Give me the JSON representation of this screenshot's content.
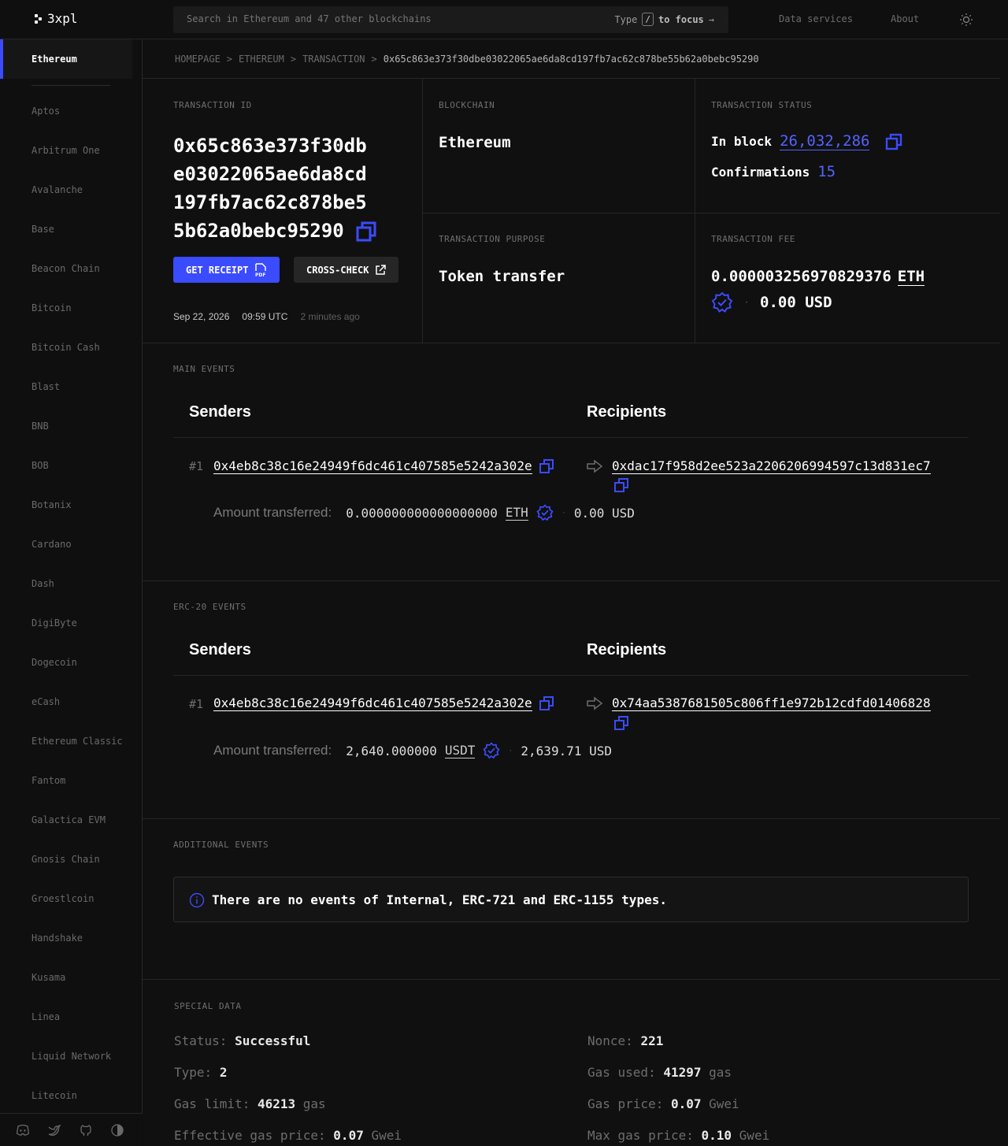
{
  "app": {
    "logo": "3xpl"
  },
  "topbar": {
    "search_placeholder": "Search in Ethereum and 47 other blockchains",
    "hint_type": "Type",
    "hint_key": "/",
    "hint_focus": "to focus",
    "nav": [
      "Data services",
      "About"
    ]
  },
  "sidebar": {
    "active": "Ethereum",
    "items": [
      "Aptos",
      "Arbitrum One",
      "Avalanche",
      "Base",
      "Beacon Chain",
      "Bitcoin",
      "Bitcoin Cash",
      "Blast",
      "BNB",
      "BOB",
      "Botanix",
      "Cardano",
      "Dash",
      "DigiByte",
      "Dogecoin",
      "eCash",
      "Ethereum Classic",
      "Fantom",
      "Galactica EVM",
      "Gnosis Chain",
      "Groestlcoin",
      "Handshake",
      "Kusama",
      "Linea",
      "Liquid Network",
      "Litecoin"
    ],
    "footer_icons": [
      "discord-icon",
      "twitter-icon",
      "github-icon",
      "contrast-icon"
    ]
  },
  "breadcrumb": [
    "HOMEPAGE",
    "ETHEREUM",
    "TRANSACTION",
    "0x65c863e373f30dbe03022065ae6da8cd197fb7ac62c878be55b62a0bebc95290"
  ],
  "tx": {
    "id_label": "TRANSACTION ID",
    "id": "0x65c863e373f30dbe03022065ae6da8cd197fb7ac62c878be55b62a0bebc95290",
    "id_lines": [
      "0x65c863e373f30db",
      "e03022065ae6da8cd",
      "197fb7ac62c878be5",
      "5b62a0bebc95290"
    ],
    "btn_receipt": "GET RECEIPT",
    "btn_crosscheck": "CROSS-CHECK",
    "date": "Sep 22, 2026",
    "time": "09:59 UTC",
    "ago": "2 minutes ago",
    "blockchain_label": "BLOCKCHAIN",
    "blockchain": "Ethereum",
    "status_label": "TRANSACTION STATUS",
    "in_block_label": "In block",
    "block": "26,032,286",
    "confirmations_label": "Confirmations",
    "confirmations": "15",
    "purpose_label": "TRANSACTION PURPOSE",
    "purpose": "Token transfer",
    "fee_label": "TRANSACTION FEE",
    "fee": "0.000003256970829376",
    "fee_unit": "ETH",
    "fee_usd": "0.00 USD"
  },
  "main_events": {
    "label": "MAIN EVENTS",
    "senders": "Senders",
    "recipients": "Recipients",
    "index": "#1",
    "sender": "0x4eb8c38c16e24949f6dc461c407585e5242a302e",
    "recipient": "0xdac17f958d2ee523a2206206994597c13d831ec7",
    "amount_label": "Amount transferred:",
    "amount": "0.000000000000000000",
    "unit": "ETH",
    "usd": "0.00 USD"
  },
  "erc20_events": {
    "label": "ERC-20 EVENTS",
    "senders": "Senders",
    "recipients": "Recipients",
    "index": "#1",
    "sender": "0x4eb8c38c16e24949f6dc461c407585e5242a302e",
    "recipient": "0x74aa5387681505c806ff1e972b12cdfd01406828",
    "amount_label": "Amount transferred:",
    "amount": "2,640.000000",
    "unit": "USDT",
    "usd": "2,639.71 USD"
  },
  "additional_events": {
    "label": "ADDITIONAL EVENTS",
    "notice": "There are no events of Internal, ERC-721 and ERC-1155 types."
  },
  "special_data": {
    "label": "SPECIAL DATA",
    "status_label": "Status:",
    "status": "Successful",
    "type_label": "Type:",
    "type": "2",
    "gas_limit_label": "Gas limit:",
    "gas_limit": "46213",
    "gas_limit_unit": "gas",
    "eff_gas_label": "Effective gas price:",
    "eff_gas": "0.07",
    "eff_gas_unit": "Gwei",
    "nonce_label": "Nonce:",
    "nonce": "221",
    "gas_used_label": "Gas used:",
    "gas_used": "41297",
    "gas_used_unit": "gas",
    "gas_price_label": "Gas price:",
    "gas_price": "0.07",
    "gas_price_unit": "Gwei",
    "max_gas_label": "Max gas price:",
    "max_gas": "0.10",
    "max_gas_unit": "Gwei"
  },
  "colors": {
    "accent": "#3b4bff",
    "link": "#5363ff",
    "bg": "#101010",
    "border": "#262626"
  }
}
